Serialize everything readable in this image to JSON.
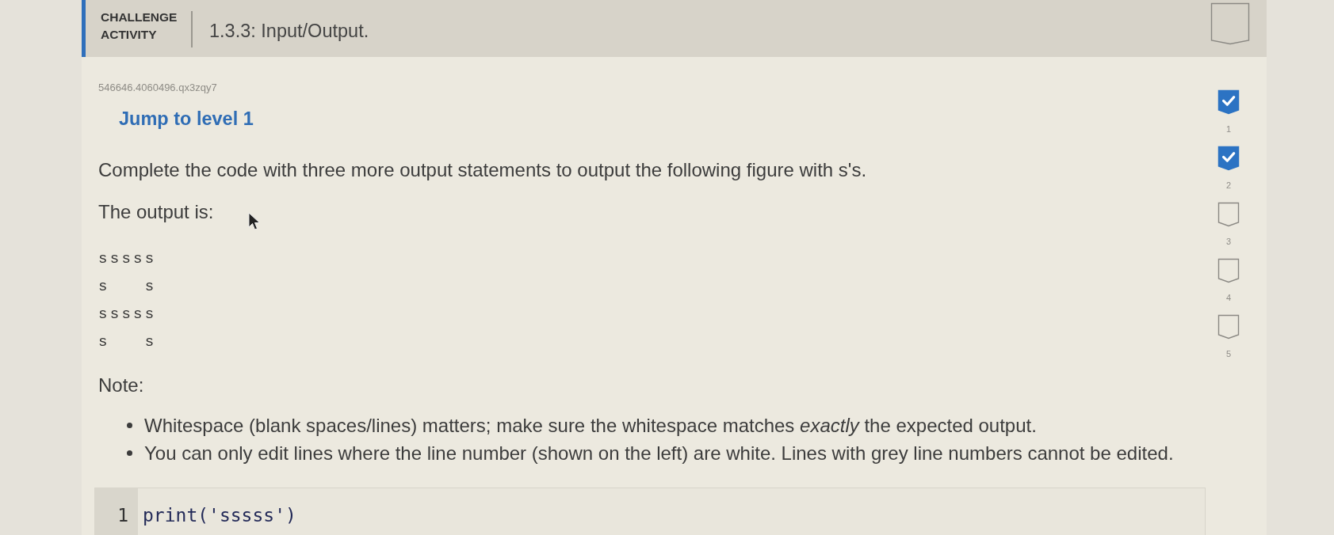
{
  "header": {
    "badge": "CHALLENGE ACTIVITY",
    "title": "1.3.3: Input/Output.",
    "completed": false
  },
  "activity_id": "546646.4060496.qx3zqy7",
  "jump_link": "Jump to level 1",
  "prompt": "Complete the code with three more output statements to output the following figure with s's.",
  "output_label": "The output is:",
  "expected_output": [
    "sssss",
    "s   s",
    "sssss",
    "s   s"
  ],
  "note_label": "Note:",
  "notes": [
    "Whitespace (blank spaces/lines) matters; make sure the whitespace matches *exactly* the expected output.",
    "You can only edit lines where the line number (shown on the left) are white. Lines with grey line numbers cannot be edited."
  ],
  "editor": {
    "lines": [
      {
        "number": "1",
        "code": "print('sssss')"
      }
    ]
  },
  "levels": [
    {
      "label": "1",
      "checked": true
    },
    {
      "label": "2",
      "checked": true
    },
    {
      "label": "3",
      "checked": false
    },
    {
      "label": "4",
      "checked": false
    },
    {
      "label": "5",
      "checked": false
    }
  ]
}
